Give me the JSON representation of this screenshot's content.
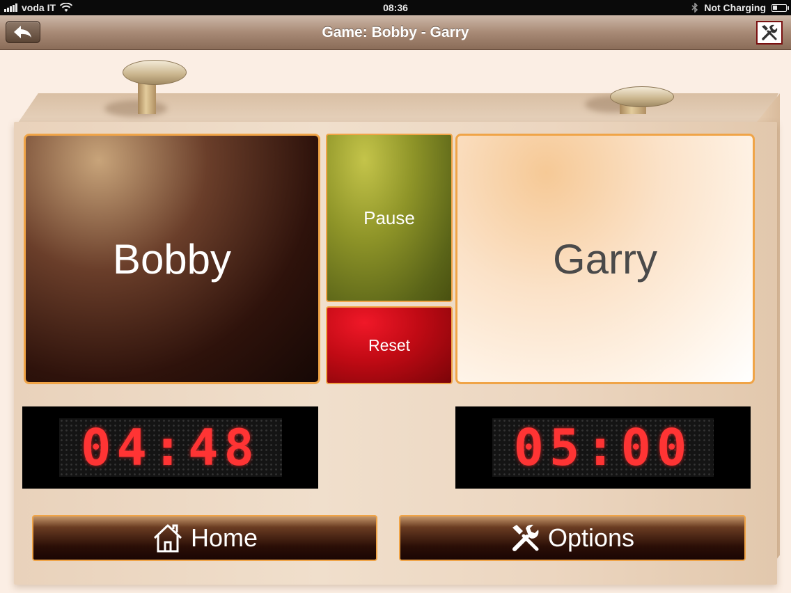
{
  "status_bar": {
    "carrier": "voda IT",
    "time": "08:36",
    "charging": "Not Charging"
  },
  "nav": {
    "title": "Game: Bobby - Garry",
    "back_icon": "back-arrow-icon",
    "tools_icon": "tools-icon"
  },
  "players": {
    "left": {
      "name": "Bobby",
      "time": "04:48"
    },
    "right": {
      "name": "Garry",
      "time": "05:00"
    }
  },
  "controls": {
    "pause_label": "Pause",
    "reset_label": "Reset"
  },
  "bottom": {
    "home_label": "Home",
    "home_icon": "home-icon",
    "options_label": "Options",
    "options_icon": "tools-icon"
  },
  "colors": {
    "accent_border": "#f0a447",
    "led": "#ff3434",
    "pause": "#8e9428",
    "reset": "#c00a14"
  }
}
